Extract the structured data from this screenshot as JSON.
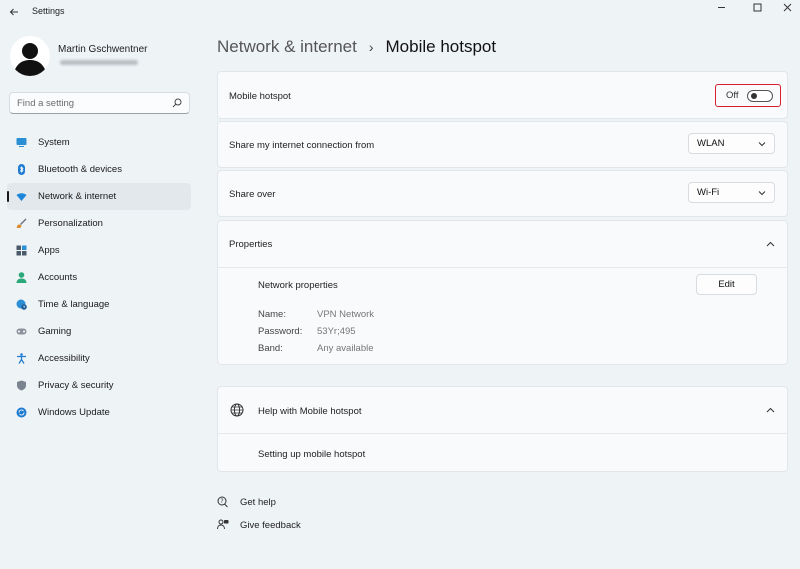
{
  "window": {
    "title": "Settings",
    "controls": [
      "minimize",
      "maximize",
      "close"
    ]
  },
  "user": {
    "name": "Martin Gschwentner"
  },
  "search": {
    "placeholder": "Find a setting"
  },
  "sidebar": {
    "items": [
      {
        "label": "System",
        "icon": "display-icon",
        "color": "#2b8fd6"
      },
      {
        "label": "Bluetooth & devices",
        "icon": "bluetooth-icon",
        "color": "#1f7bd1"
      },
      {
        "label": "Network & internet",
        "icon": "wifi-icon",
        "color": "#1d86d8",
        "selected": true
      },
      {
        "label": "Personalization",
        "icon": "brush-icon",
        "color": "#d98a2a"
      },
      {
        "label": "Apps",
        "icon": "apps-icon",
        "color": "#4a5a6a"
      },
      {
        "label": "Accounts",
        "icon": "person-icon",
        "color": "#2aa87a"
      },
      {
        "label": "Time & language",
        "icon": "globe-clock-icon",
        "color": "#2b8fd6"
      },
      {
        "label": "Gaming",
        "icon": "gamepad-icon",
        "color": "#6a7480"
      },
      {
        "label": "Accessibility",
        "icon": "accessibility-icon",
        "color": "#1f7bd1"
      },
      {
        "label": "Privacy & security",
        "icon": "shield-icon",
        "color": "#7a848f"
      },
      {
        "label": "Windows Update",
        "icon": "update-icon",
        "color": "#1f7bd1"
      }
    ]
  },
  "breadcrumb": {
    "parent": "Network & internet",
    "separator": "›",
    "current": "Mobile hotspot"
  },
  "hotspot": {
    "label": "Mobile hotspot",
    "state": "Off"
  },
  "share_from": {
    "label": "Share my internet connection from",
    "value": "WLAN"
  },
  "share_over": {
    "label": "Share over",
    "value": "Wi-Fi"
  },
  "properties": {
    "title": "Properties",
    "network_properties_label": "Network properties",
    "edit_label": "Edit",
    "rows": [
      {
        "key": "Name:",
        "value": "VPN Network"
      },
      {
        "key": "Password:",
        "value": "53Yr;495"
      },
      {
        "key": "Band:",
        "value": "Any available"
      }
    ]
  },
  "help": {
    "title": "Help with Mobile hotspot",
    "link": "Setting up mobile hotspot"
  },
  "footer": {
    "get_help": "Get help",
    "give_feedback": "Give feedback"
  },
  "colors": {
    "accent": "#1d86d8",
    "highlight_border": "#d2202f"
  }
}
